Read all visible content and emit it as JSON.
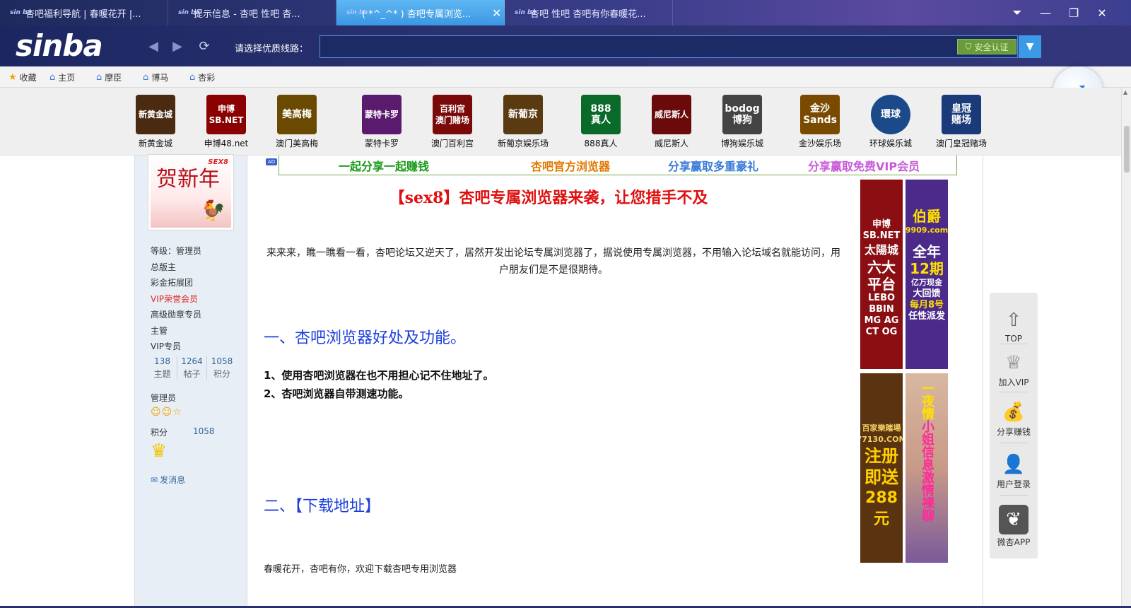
{
  "tabs": [
    {
      "label": "杏吧福利导航 | 春暖花开 |..."
    },
    {
      "label": "提示信息 - 杏吧 性吧 杏..."
    },
    {
      "label": "( *^_^* ) 杏吧专属浏览..."
    },
    {
      "label": "杏吧 性吧 杏吧有你春暖花..."
    }
  ],
  "tab_icon_text": "sin ba",
  "toolbar": {
    "logo": "sinba",
    "route_label": "请选择优质线路：",
    "address_value": "",
    "secure_badge": "安全认证"
  },
  "bookmarks": [
    {
      "label": "收藏",
      "icon": "star-icon"
    },
    {
      "label": "主页",
      "icon": "home-icon"
    },
    {
      "label": "摩臣",
      "icon": "home-icon"
    },
    {
      "label": "博马",
      "icon": "home-icon"
    },
    {
      "label": "杏彩",
      "icon": "home-icon"
    }
  ],
  "casinos": [
    {
      "name": "新黄金城",
      "logo": "新黄金城",
      "color": "#4a2a10"
    },
    {
      "name": "申博48.net",
      "logo": "申博\nSB.NET",
      "color": "#8b0000"
    },
    {
      "name": "澳门美高梅",
      "logo": "美高梅",
      "color": "#6a4a00"
    },
    {
      "name": "蒙特卡罗",
      "logo": "蒙特卡罗",
      "color": "#5a1a6e"
    },
    {
      "name": "澳门百利宫",
      "logo": "百利宫\n澳门赌场",
      "color": "#7a0a0a"
    },
    {
      "name": "新葡京娱乐场",
      "logo": "新葡京",
      "color": "#5a3a10"
    },
    {
      "name": "888真人",
      "logo": "888\n真人",
      "color": "#0a6a2a"
    },
    {
      "name": "威尼斯人",
      "logo": "威尼斯人",
      "color": "#6a0a0a"
    },
    {
      "name": "博狗娱乐城",
      "logo": "bodog\n博狗",
      "color": "#444444"
    },
    {
      "name": "金沙娱乐场",
      "logo": "金沙\nSands",
      "color": "#7a4a00"
    },
    {
      "name": "环球娱乐城",
      "logo": "環球",
      "color": "#1a4a8a"
    },
    {
      "name": "澳门皇冠赌场",
      "logo": "皇冠\n赌场",
      "color": "#1a3a7a"
    }
  ],
  "user": {
    "avatar_text": "贺新年",
    "avatar_tag": "SEX8",
    "roles": [
      "等级：管理员",
      "总版主",
      "彩金拓展团",
      "VIP荣誉会员",
      "高级勋章专员",
      "主管",
      "VIP专员"
    ],
    "stats": [
      {
        "num": "138",
        "label": "主题"
      },
      {
        "num": "1264",
        "label": "帖子"
      },
      {
        "num": "1058",
        "label": "积分"
      }
    ],
    "group": "管理员",
    "points_label": "积分",
    "points_value": "1058",
    "send_message": "发消息"
  },
  "content": {
    "ad_tag": "AD",
    "promo": [
      "一起分享一起赚钱",
      "杏吧官方浏览器",
      "分享赢取多重豪礼",
      "分享赢取免费VIP会员"
    ],
    "promo_colors": [
      "#1a9a1a",
      "#e07800",
      "#3a7ad8",
      "#c85ad8"
    ],
    "title": "【sex8】杏吧专属浏览器来袭，让您措手不及",
    "intro": "来来来，瞧一瞧看一看，杏吧论坛又逆天了，居然开发出论坛专属浏览器了，据说使用专属浏览器，不用输入论坛域名就能访问，用户朋友们是不是很期待。",
    "heading1": "一、杏吧浏览器好处及功能。",
    "features": [
      "1、使用杏吧浏览器在也不用担心记不住地址了。",
      "2、杏吧浏览器自带测速功能。"
    ],
    "heading2": "二、【下载地址】",
    "footer": "春暖花开，杏吧有你，欢迎下载杏吧专用浏览器"
  },
  "ads": {
    "ad1": [
      "申博",
      "SB.NET",
      "太陽城",
      "六大",
      "平台",
      "LEBO",
      "BBIN",
      "MG AG",
      "CT OG"
    ],
    "ad2": [
      "伯爵",
      "9909.com",
      "全年",
      "12期",
      "亿万现金",
      "大回馈",
      "每月8号",
      "任性派发"
    ],
    "ad3": [
      "百家樂賭場",
      "77130.COM",
      "注册",
      "即送",
      "288元"
    ],
    "ad4": [
      "一夜情",
      "小姐信息",
      "激情裸聊"
    ]
  },
  "floatbar": [
    {
      "label": "TOP",
      "icon": "top-arrow-icon"
    },
    {
      "label": "加入VIP",
      "icon": "crown-icon"
    },
    {
      "label": "分享赚钱",
      "icon": "money-bag-icon"
    },
    {
      "label": "用户登录",
      "icon": "user-icon"
    },
    {
      "label": "微杏APP",
      "icon": "app-icon"
    }
  ]
}
